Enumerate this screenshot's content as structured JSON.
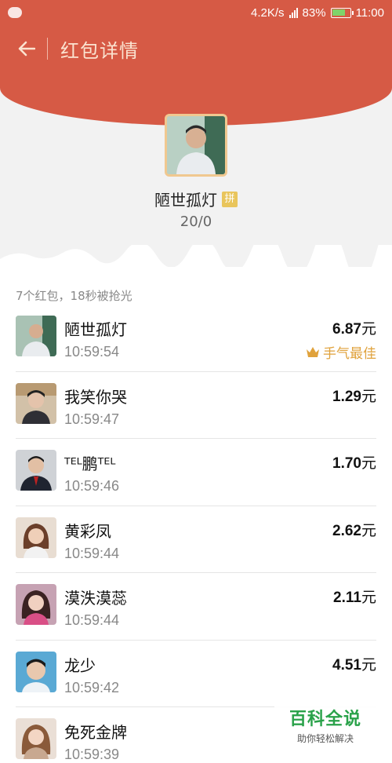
{
  "statusbar": {
    "network_speed": "4.2K/s",
    "battery": "83%",
    "time": "11:00"
  },
  "nav": {
    "title": "红包详情"
  },
  "sender": {
    "name": "陋世孤灯",
    "pin_badge": "拼",
    "count": "20/0"
  },
  "summary": "7个红包，18秒被抢光",
  "unit": "元",
  "best_label": "手气最佳",
  "rows": [
    {
      "name": "陋世孤灯",
      "time": "10:59:54",
      "amount": "6.87",
      "avatar_color": "#9fb7a8"
    },
    {
      "name": "我笑你哭",
      "time": "10:59:47",
      "amount": "1.29",
      "avatar_color": "#c9b49a"
    },
    {
      "name": "ᵀᴱᴸ鹏ᵀᴱᴸ",
      "time": "10:59:46",
      "amount": "1.70",
      "avatar_color": "#8a8f99"
    },
    {
      "name": "黄彩凤",
      "time": "10:59:44",
      "amount": "2.62",
      "avatar_color": "#d9b79c"
    },
    {
      "name": "漠泆漠蕊",
      "time": "10:59:44",
      "amount": "2.11",
      "avatar_color": "#c98b9d"
    },
    {
      "name": "龙少",
      "time": "10:59:42",
      "amount": "4.51",
      "avatar_color": "#6fb0d6"
    },
    {
      "name": "免死金牌",
      "time": "10:59:39",
      "amount": "",
      "avatar_color": "#d8c2b2"
    }
  ],
  "watermark": {
    "title": "百科全说",
    "subtitle": "助你轻松解决"
  },
  "colors": {
    "header_red": "#d65a45",
    "best_gold": "#e0a23c"
  }
}
